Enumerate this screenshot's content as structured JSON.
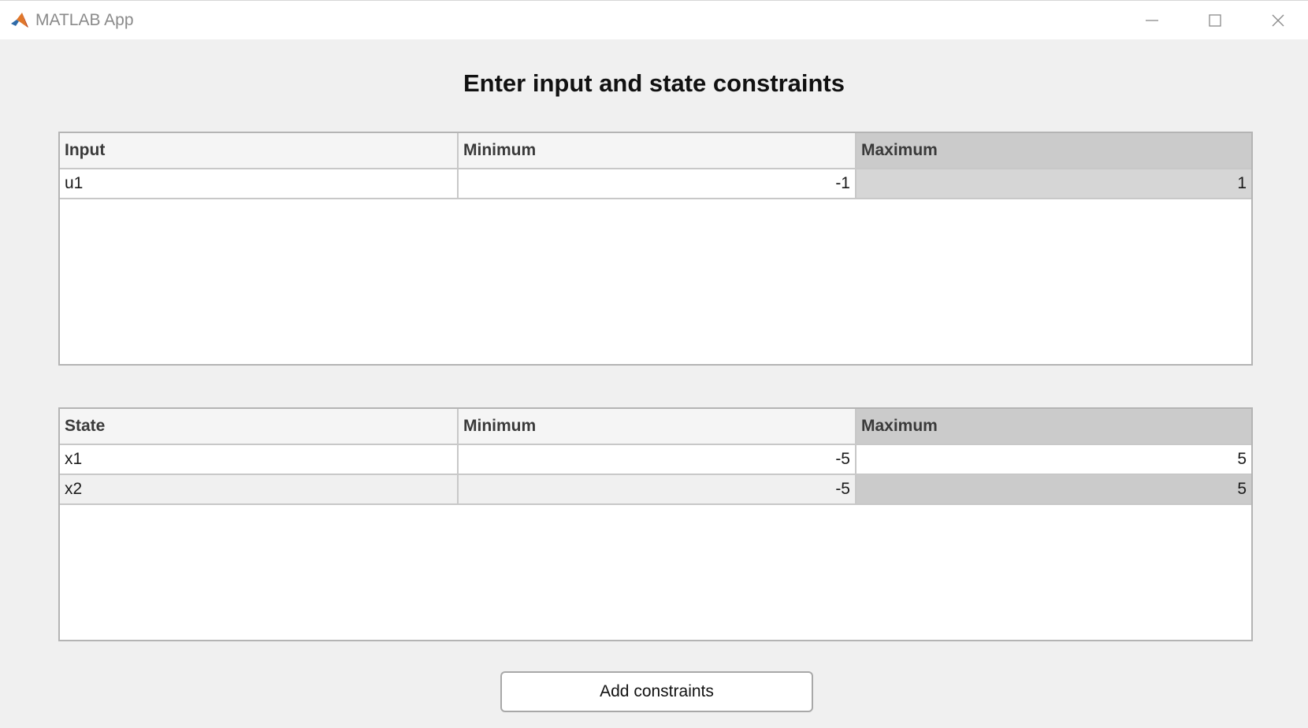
{
  "window": {
    "title": "MATLAB App",
    "icon": "matlab-logo-icon"
  },
  "heading": "Enter input and state constraints",
  "input_table": {
    "columns": [
      "Input",
      "Minimum",
      "Maximum"
    ],
    "rows": [
      [
        "u1",
        "-1",
        "1"
      ]
    ]
  },
  "state_table": {
    "columns": [
      "State",
      "Minimum",
      "Maximum"
    ],
    "rows": [
      [
        "x1",
        "-5",
        "5"
      ],
      [
        "x2",
        "-5",
        "5"
      ]
    ]
  },
  "add_button_label": "Add constraints",
  "colors": {
    "background": "#f0f0f0",
    "selected_column": "#cbcbcb"
  }
}
